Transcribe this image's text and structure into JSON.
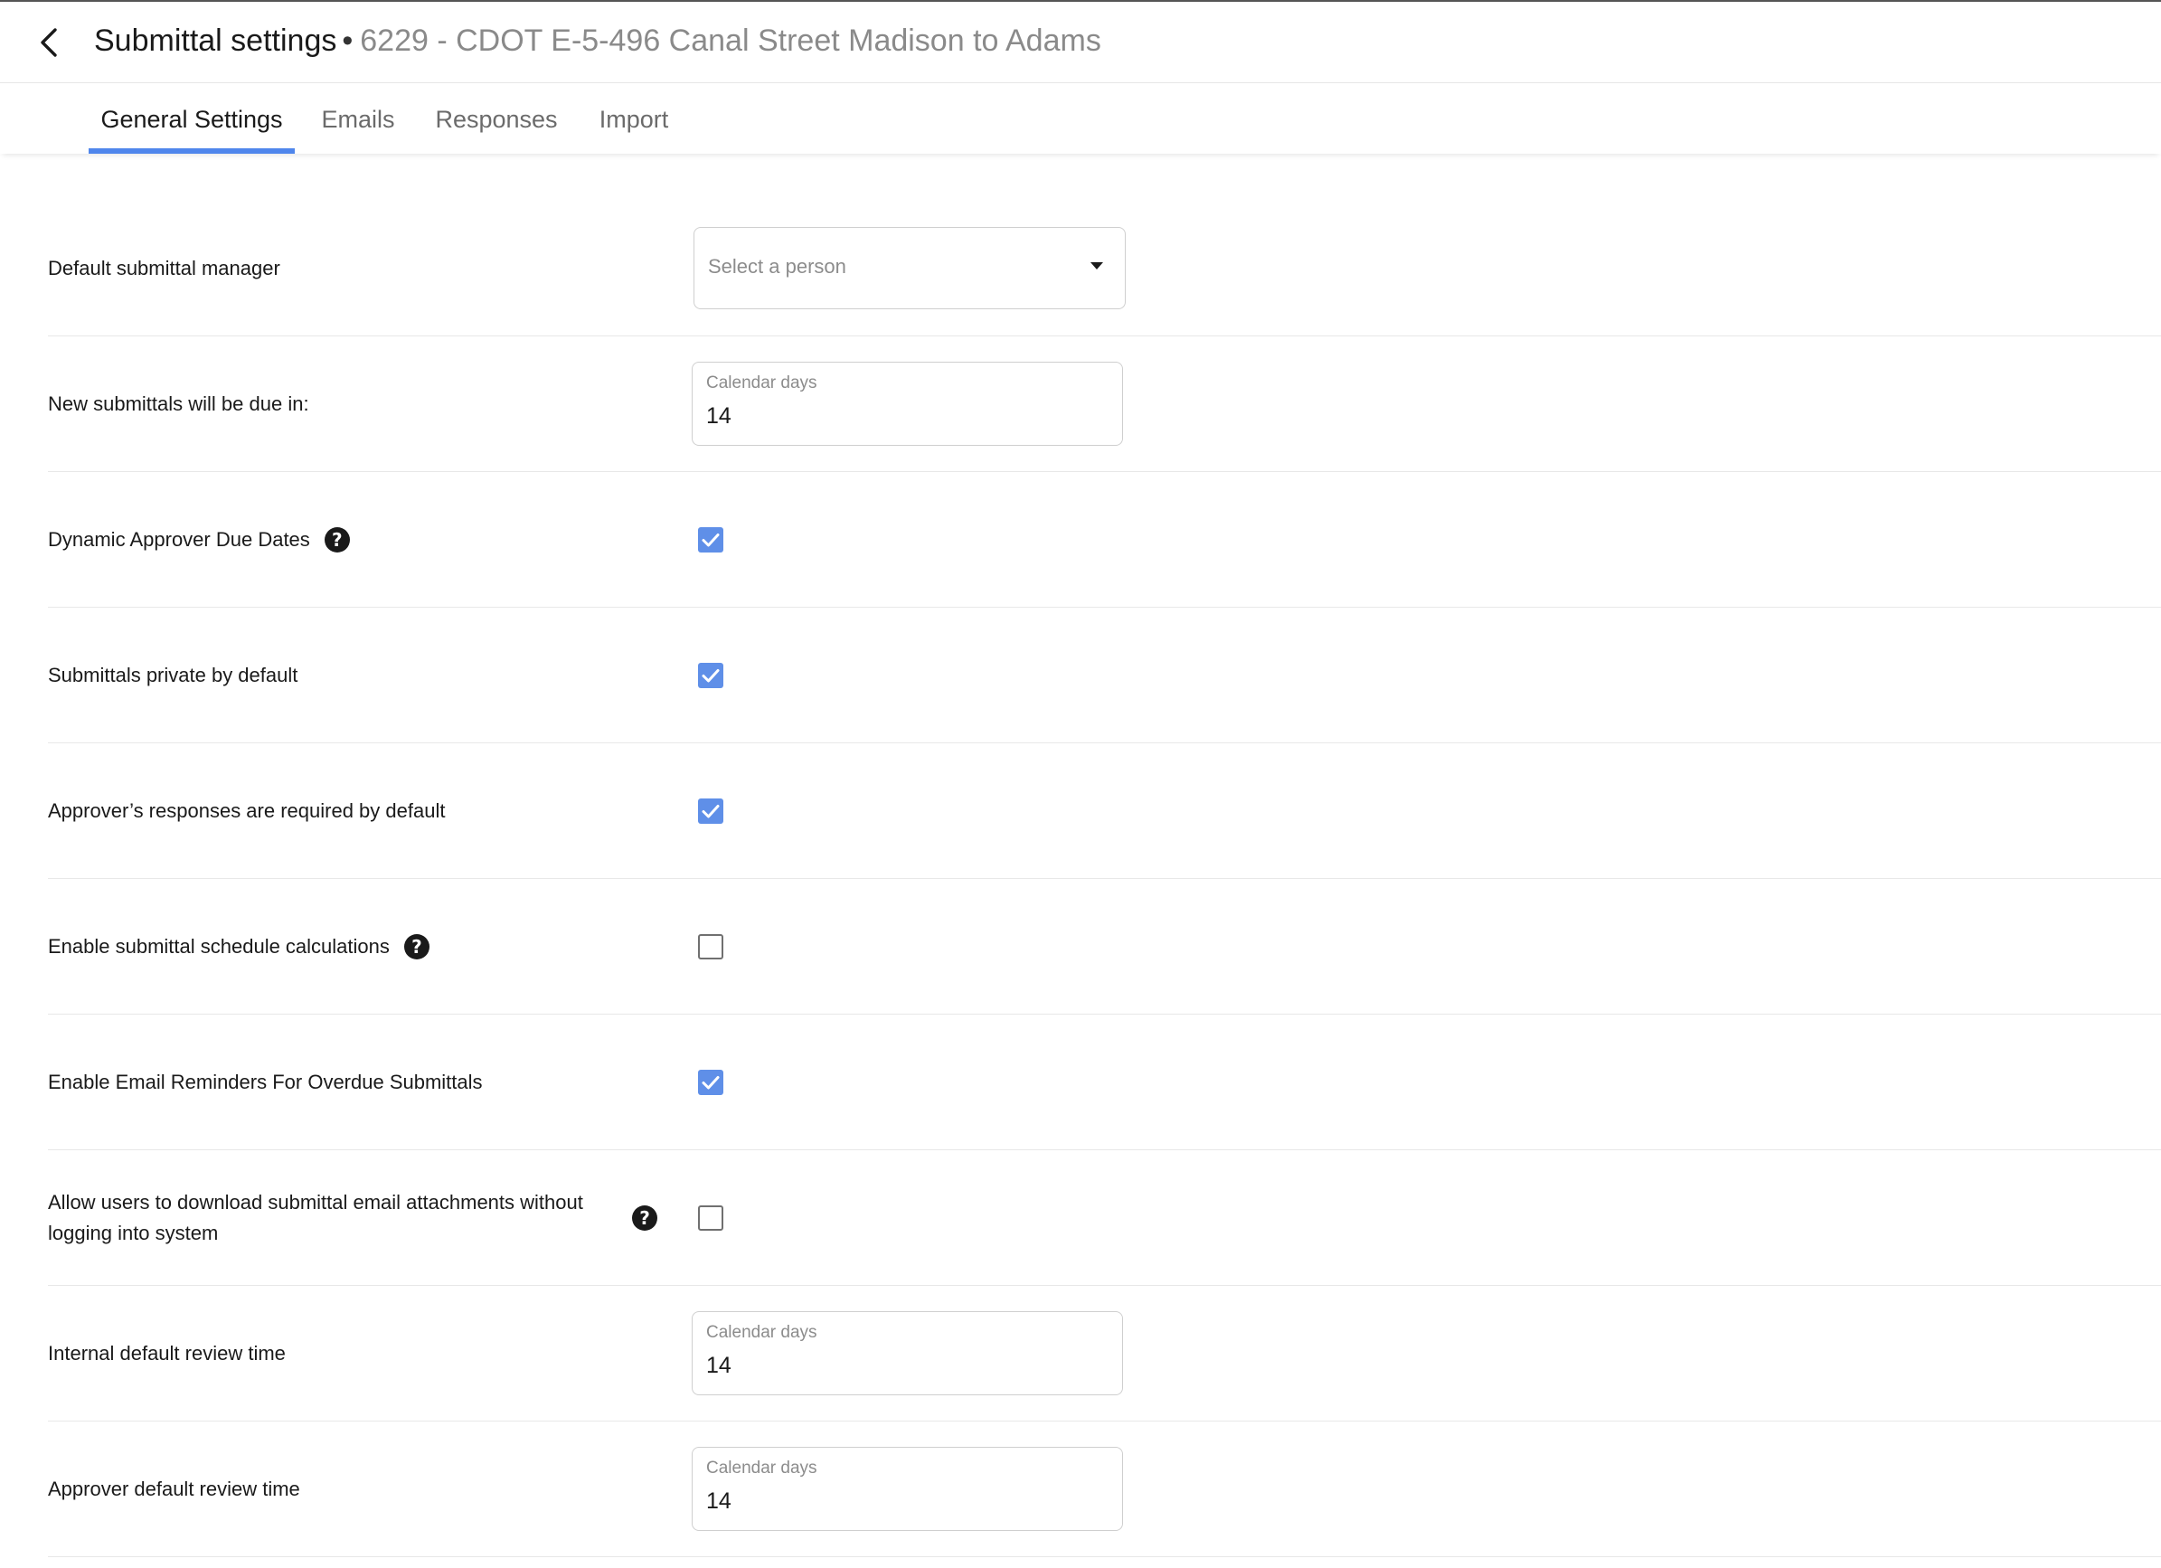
{
  "header": {
    "title": "Submittal settings",
    "separator": "•",
    "project": "6229 - CDOT E-5-496 Canal Street Madison to Adams"
  },
  "tabs": [
    {
      "label": "General Settings",
      "active": true
    },
    {
      "label": "Emails",
      "active": false
    },
    {
      "label": "Responses",
      "active": false
    },
    {
      "label": "Import",
      "active": false
    }
  ],
  "settings": {
    "manager": {
      "label": "Default submittal manager",
      "placeholder": "Select a person"
    },
    "due_in": {
      "label": "New submittals will be due in:",
      "field_label": "Calendar days",
      "value": "14"
    },
    "dynamic_due": {
      "label": "Dynamic Approver Due Dates",
      "checked": true
    },
    "private_default": {
      "label": "Submittals private by default",
      "checked": true
    },
    "responses_required": {
      "label": "Approver’s responses are required by default",
      "checked": true
    },
    "schedule_calc": {
      "label": "Enable submittal schedule calculations",
      "checked": false
    },
    "email_reminders": {
      "label": "Enable Email Reminders For Overdue Submittals",
      "checked": true
    },
    "download_attachments": {
      "label": "Allow users to download submittal email attachments without logging into system",
      "checked": false
    },
    "internal_review": {
      "label": "Internal default review time",
      "field_label": "Calendar days",
      "value": "14"
    },
    "approver_review": {
      "label": "Approver default review time",
      "field_label": "Calendar days",
      "value": "14"
    }
  },
  "colors": {
    "accent": "#4f86ec",
    "checkbox": "#5f8fe8"
  }
}
